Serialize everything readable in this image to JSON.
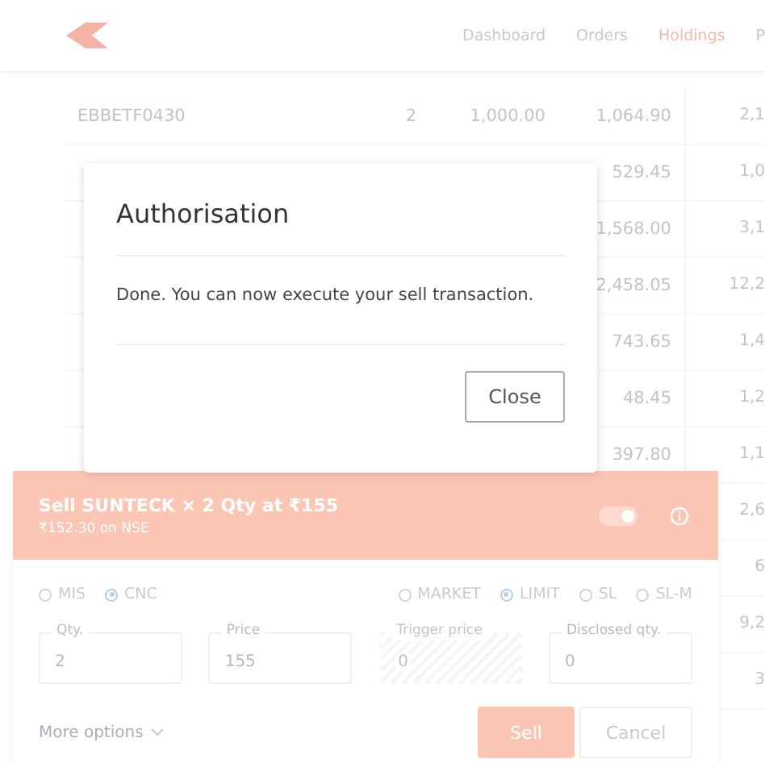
{
  "nav": {
    "items": [
      {
        "label": "Dashboard",
        "selected": false
      },
      {
        "label": "Orders",
        "selected": false
      },
      {
        "label": "Holdings",
        "selected": true
      },
      {
        "label": "P",
        "selected": false
      }
    ]
  },
  "holdings": {
    "rows": [
      {
        "name": "EBBETF0430",
        "qty": "2",
        "avg": "1,000.00",
        "ltp": "1,064.90",
        "column_5": "2,1"
      },
      {
        "ltp": "529.45",
        "column_5": "1,0"
      },
      {
        "ltp": "1,568.00",
        "column_5": "3,1"
      },
      {
        "ltp": "2,458.05",
        "column_5": "12,2"
      },
      {
        "ltp": "743.65",
        "column_5": "1,4"
      },
      {
        "ltp": "48.45",
        "column_5": "1,2"
      },
      {
        "ltp": "397.80",
        "column_5": "1,1"
      },
      {
        "column_5": "2,6"
      },
      {
        "column_5": "6"
      },
      {
        "column_5": "9,2"
      },
      {
        "column_5": "3"
      }
    ]
  },
  "order": {
    "title": "Sell SUNTECK × 2 Qty at ₹155",
    "subtitle": "₹152.30 on NSE",
    "toggle_on": true,
    "products": [
      {
        "label": "MIS",
        "selected": false
      },
      {
        "label": "CNC",
        "selected": true
      }
    ],
    "order_types": [
      {
        "label": "MARKET",
        "selected": false
      },
      {
        "label": "LIMIT",
        "selected": true
      },
      {
        "label": "SL",
        "selected": false
      },
      {
        "label": "SL-M",
        "selected": false
      }
    ],
    "fields": [
      {
        "label": "Qty.",
        "value": "2",
        "disabled": false
      },
      {
        "label": "Price",
        "value": "155",
        "disabled": false
      },
      {
        "label": "Trigger price",
        "value": "0",
        "disabled": true
      },
      {
        "label": "Disclosed qty.",
        "value": "0",
        "disabled": false
      }
    ],
    "more_options": "More options",
    "buttons": {
      "primary": "Sell",
      "secondary": "Cancel"
    }
  },
  "dialog": {
    "title": "Authorisation",
    "message": "Done. You can now execute your sell transaction.",
    "button": "Close"
  }
}
